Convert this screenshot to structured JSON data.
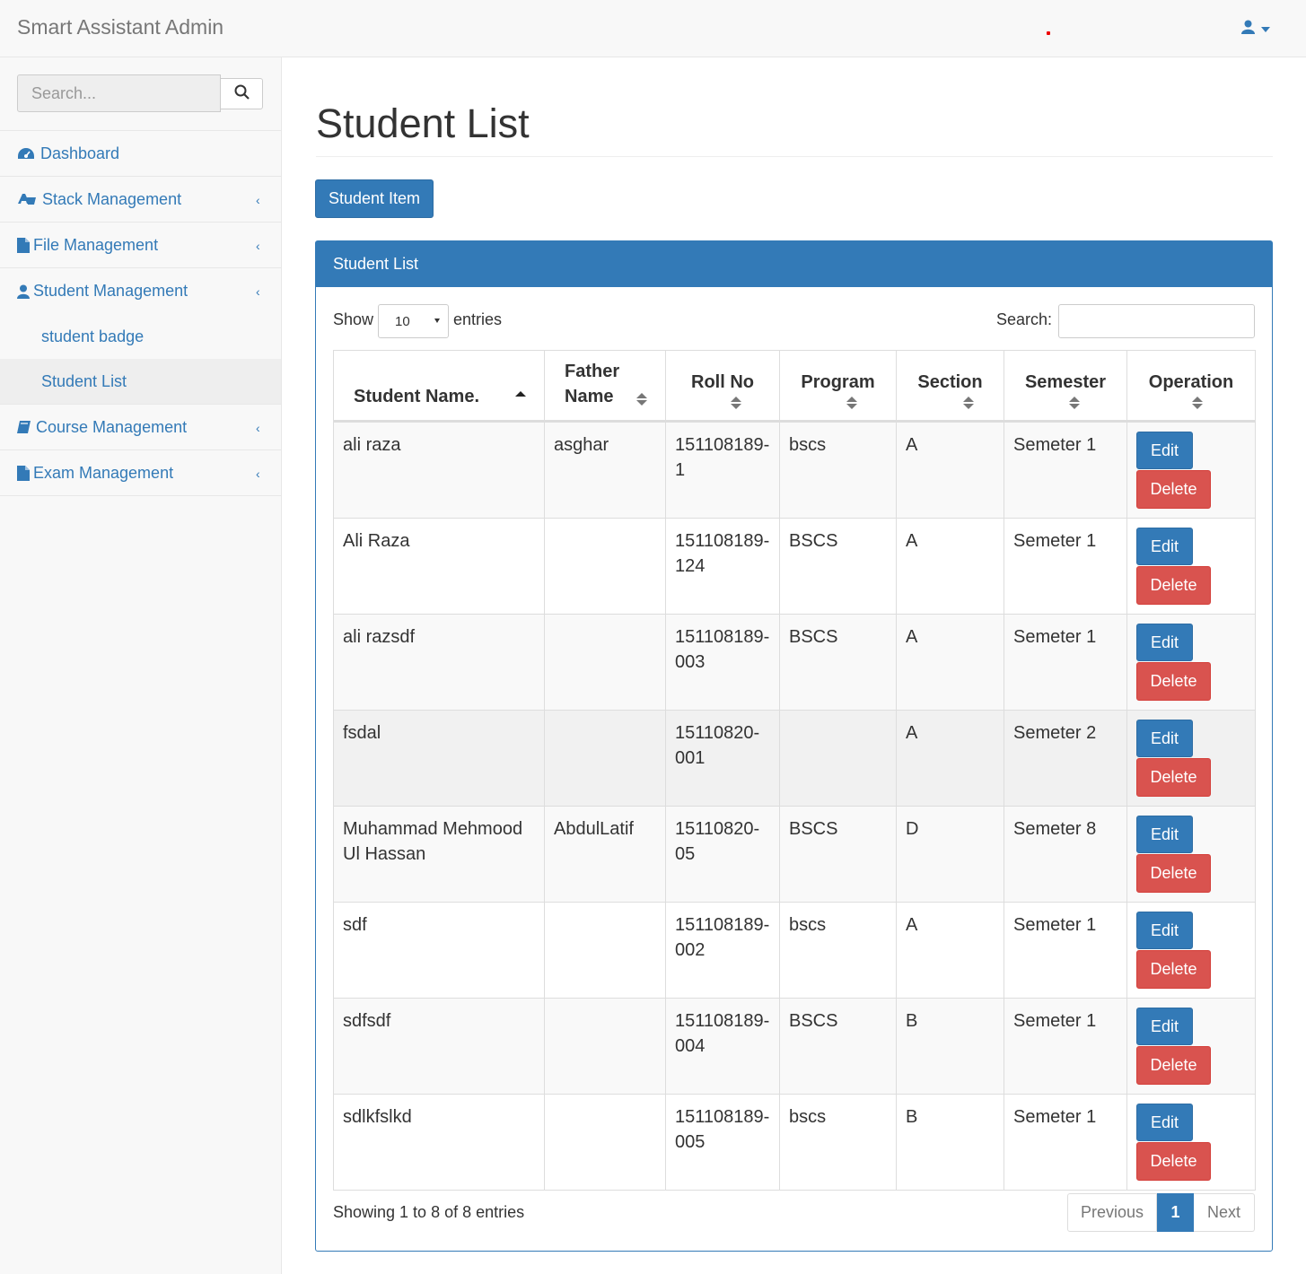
{
  "navbar": {
    "brand": "Smart Assistant Admin",
    "user_icon": "user-icon"
  },
  "sidebar": {
    "search_placeholder": "Search...",
    "items": [
      {
        "label": "Dashboard",
        "icon": "dashboard-icon"
      },
      {
        "label": "Stack Management",
        "icon": "stack-icon"
      },
      {
        "label": "File Management",
        "icon": "file-icon"
      },
      {
        "label": "Student Management",
        "icon": "user-icon"
      },
      {
        "label": "Course Management",
        "icon": "book-icon"
      },
      {
        "label": "Exam Management",
        "icon": "file-icon"
      }
    ],
    "sub_items": [
      {
        "label": "student badge"
      },
      {
        "label": "Student List"
      }
    ]
  },
  "main": {
    "title": "Student List",
    "add_button": "Student Item",
    "panel_title": "Student List",
    "show_label": "Show",
    "entries_value": "10",
    "entries_label": "entries",
    "search_label": "Search:",
    "columns": [
      "Student Name.",
      "Father Name",
      "Roll No",
      "Program",
      "Section",
      "Semester",
      "Operation"
    ],
    "edit_label": "Edit",
    "delete_label": "Delete",
    "rows": [
      [
        "ali raza",
        "asghar",
        "151108189-1",
        "bscs",
        "A",
        "Semeter 1"
      ],
      [
        "Ali Raza",
        "",
        "151108189-124",
        "BSCS",
        "A",
        "Semeter 1"
      ],
      [
        "ali razsdf",
        "",
        "151108189-003",
        "BSCS",
        "A",
        "Semeter 1"
      ],
      [
        "fsdal",
        "",
        "15110820-001",
        "",
        "A",
        "Semeter 2"
      ],
      [
        "Muhammad Mehmood Ul Hassan",
        "AbdulLatif",
        "15110820-05",
        "BSCS",
        "D",
        "Semeter 8"
      ],
      [
        "sdf",
        "",
        "151108189-002",
        "bscs",
        "A",
        "Semeter 1"
      ],
      [
        "sdfsdf",
        "",
        "151108189-004",
        "BSCS",
        "B",
        "Semeter 1"
      ],
      [
        "sdlkfslkd",
        "",
        "151108189-005",
        "bscs",
        "B",
        "Semeter 1"
      ]
    ],
    "info": "Showing 1 to 8 of 8 entries",
    "pager": {
      "prev": "Previous",
      "current": "1",
      "next": "Next"
    }
  },
  "colors": {
    "primary": "#337ab7",
    "danger": "#d9534f"
  }
}
